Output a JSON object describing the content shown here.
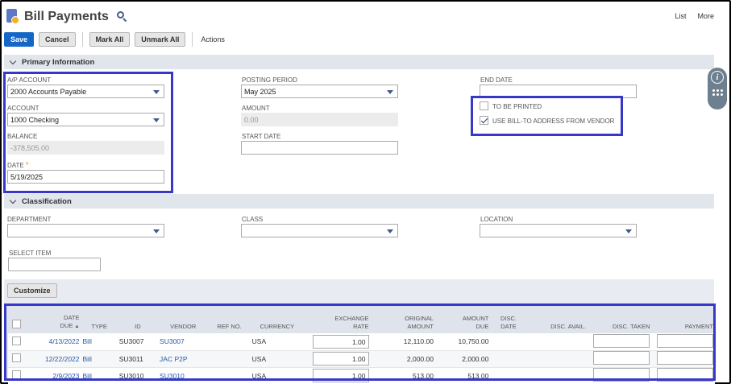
{
  "header": {
    "title": "Bill Payments",
    "links": [
      "List",
      "More"
    ]
  },
  "toolbar": {
    "save": "Save",
    "cancel": "Cancel",
    "mark_all": "Mark All",
    "unmark_all": "Unmark All",
    "actions": "Actions"
  },
  "primary": {
    "section_title": "Primary Information",
    "ap_account": {
      "label": "A/P ACCOUNT",
      "value": "2000 Accounts Payable"
    },
    "account": {
      "label": "ACCOUNT",
      "value": "1000 Checking"
    },
    "balance": {
      "label": "BALANCE",
      "value": "-378,505.00"
    },
    "date": {
      "label": "DATE",
      "value": "5/19/2025",
      "required_mark": "*"
    },
    "posting_period": {
      "label": "POSTING PERIOD",
      "value": "May 2025"
    },
    "amount": {
      "label": "AMOUNT",
      "value": "0.00"
    },
    "start_date": {
      "label": "START DATE",
      "value": ""
    },
    "end_date": {
      "label": "END DATE",
      "value": ""
    },
    "to_be_printed": {
      "label": "TO BE PRINTED",
      "checked": false
    },
    "use_bill_to": {
      "label": "USE BILL-TO ADDRESS FROM VENDOR",
      "checked": true
    }
  },
  "classification": {
    "section_title": "Classification",
    "department": {
      "label": "DEPARTMENT",
      "value": ""
    },
    "class": {
      "label": "CLASS",
      "value": ""
    },
    "location": {
      "label": "LOCATION",
      "value": ""
    },
    "select_item": {
      "label": "SELECT ITEM",
      "value": ""
    }
  },
  "list": {
    "customize": "Customize",
    "columns": {
      "date_due_1": "DATE",
      "date_due_2": "DUE",
      "sort_arrow": "▲",
      "type": "TYPE",
      "id": "ID",
      "vendor": "VENDOR",
      "ref_no": "REF NO.",
      "currency": "CURRENCY",
      "exchange_rate_1": "EXCHANGE",
      "exchange_rate_2": "RATE",
      "original_amount_1": "ORIGINAL",
      "original_amount_2": "AMOUNT",
      "amount_due_1": "AMOUNT",
      "amount_due_2": "DUE",
      "disc_date_1": "DISC.",
      "disc_date_2": "DATE",
      "disc_avail": "DISC. AVAIL.",
      "disc_taken": "DISC. TAKEN",
      "payment": "PAYMENT"
    },
    "rows": [
      {
        "date_due": "4/13/2022",
        "type": "Bill",
        "id": "SU3007",
        "vendor": "SU3007",
        "ref_no": "",
        "currency": "USA",
        "exchange_rate": "1.00",
        "original_amount": "12,110.00",
        "amount_due": "10,750.00",
        "disc_date": "",
        "disc_avail": ""
      },
      {
        "date_due": "12/22/2022",
        "type": "Bill",
        "id": "SU3011",
        "vendor": "JAC P2P",
        "ref_no": "",
        "currency": "USA",
        "exchange_rate": "1.00",
        "original_amount": "2,000.00",
        "amount_due": "2,000.00",
        "disc_date": "",
        "disc_avail": ""
      },
      {
        "date_due": "2/9/2023",
        "type": "Bill",
        "id": "SU3010",
        "vendor": "SU3010",
        "ref_no": "",
        "currency": "USA",
        "exchange_rate": "1.00",
        "original_amount": "513.00",
        "amount_due": "513.00",
        "disc_date": "",
        "disc_avail": ""
      }
    ]
  },
  "colors": {
    "primary_button": "#1467c6",
    "highlight": "#3838c8",
    "section_bar": "#e1e5ec",
    "link": "#255aa8"
  }
}
